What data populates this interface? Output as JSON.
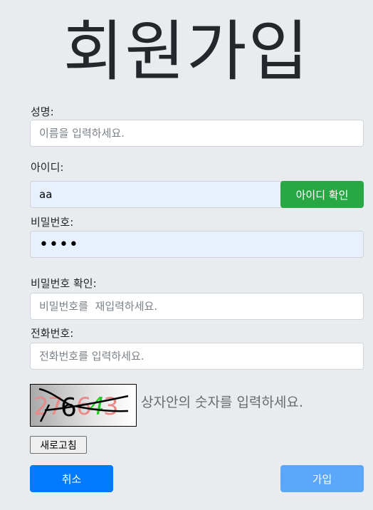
{
  "page_title": "회원가입",
  "form": {
    "name": {
      "label": "성명:",
      "placeholder": "이름을 입력하세요.",
      "value": ""
    },
    "userid": {
      "label": "아이디:",
      "value": "aa",
      "check_button": "아이디 확인"
    },
    "password": {
      "label": "비밀번호:",
      "value": "aaaa"
    },
    "password_confirm": {
      "label": "비밀번호 확인:",
      "placeholder": "비밀번호를  재입력하세요.",
      "value": ""
    },
    "phone": {
      "label": "전화번호:",
      "placeholder": "전화번호를 입력하세요.",
      "value": ""
    }
  },
  "captcha": {
    "text": "27643",
    "hint": "상자안의 숫자를 입력하세요.",
    "refresh_label": "새로고침"
  },
  "buttons": {
    "cancel": "취소",
    "join": "가입"
  },
  "colors": {
    "background": "#e9ecef",
    "check_button": "#28a745",
    "cancel_button": "#007bff",
    "join_button": "#5aa7fb",
    "autofill": "#e8f0fe"
  }
}
